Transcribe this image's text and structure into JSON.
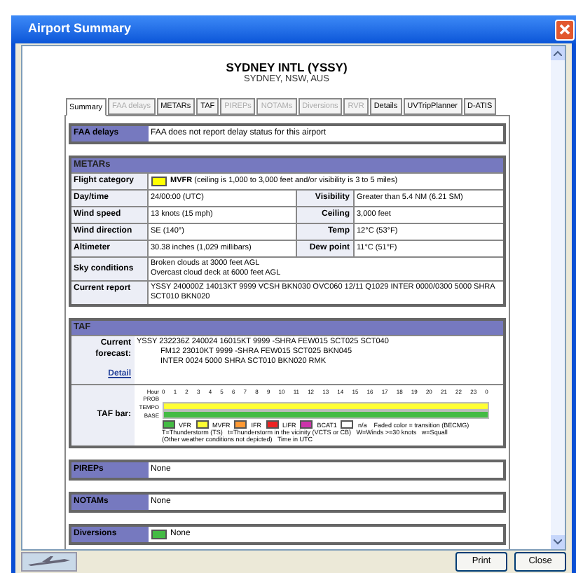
{
  "window": {
    "title": "Airport Summary"
  },
  "airport": {
    "name": "SYDNEY INTL (YSSY)",
    "location": "SYDNEY, NSW, AUS"
  },
  "tabs": [
    {
      "label": "Summary",
      "selected": true,
      "disabled": false
    },
    {
      "label": "FAA delays",
      "selected": false,
      "disabled": true
    },
    {
      "label": "METARs",
      "selected": false,
      "disabled": false
    },
    {
      "label": "TAF",
      "selected": false,
      "disabled": false
    },
    {
      "label": "PIREPs",
      "selected": false,
      "disabled": true
    },
    {
      "label": "NOTAMs",
      "selected": false,
      "disabled": true
    },
    {
      "label": "Diversions",
      "selected": false,
      "disabled": true
    },
    {
      "label": "RVR",
      "selected": false,
      "disabled": true
    },
    {
      "label": "Details",
      "selected": false,
      "disabled": false
    },
    {
      "label": "UVTripPlanner",
      "selected": false,
      "disabled": false
    },
    {
      "label": "D-ATIS",
      "selected": false,
      "disabled": false
    }
  ],
  "faa_delays": {
    "label": "FAA delays",
    "value": "FAA does not report delay status for this airport"
  },
  "metars": {
    "title": "METARs",
    "flight_category": {
      "label": "Flight category",
      "color": "#ffff00",
      "value": "**MVFR** (ceiling is 1,000 to 3,000 feet and/or visibility is 3 to 5 miles)"
    },
    "rows": [
      {
        "label": "Day/time",
        "value": "24/00:00 (UTC)",
        "label_2": "Visibility",
        "value_2": "Greater than 5.4 NM (6.21 SM)"
      },
      {
        "label": "Wind speed",
        "value": "13 knots (15 mph)",
        "label_2": "Ceiling",
        "value_2": "3,000 feet"
      },
      {
        "label": "Wind direction",
        "value": "SE (140°)",
        "label_2": "Temp",
        "value_2": "12°C (53°F)"
      },
      {
        "label": "Altimeter",
        "value": "30.38 inches (1,029 millibars)",
        "label_2": "Dew point",
        "value_2": "11°C (51°F)"
      }
    ],
    "sky": {
      "label": "Sky conditions",
      "lines": [
        "Broken clouds at 3000 feet AGL",
        "Overcast cloud deck at 6000 feet AGL"
      ]
    },
    "report": {
      "label": "Current report",
      "value": "YSSY 240000Z 14013KT 9999 VCSH BKN030 OVC060 12/11 Q1029 INTER 0000/0300 5000 SHRA SCT010 BKN020"
    }
  },
  "taf": {
    "title": "TAF",
    "forecast_label": "Current forecast:",
    "forecast_lines": [
      "YSSY 232236Z 240024 16015KT 9999 -SHRA FEW015 SCT025 SCT040",
      "FM12 23010KT 9999 -SHRA FEW015 SCT025 BKN045",
      "INTER 0024 5000 SHRA SCT010 BKN020 RMK"
    ],
    "detail_link": "Detail",
    "bar_label": "TAF bar:",
    "hour_label": "Hour",
    "hours": [
      "0",
      "1",
      "2",
      "3",
      "4",
      "5",
      "6",
      "7",
      "8",
      "9",
      "10",
      "11",
      "12",
      "13",
      "14",
      "15",
      "16",
      "17",
      "18",
      "19",
      "20",
      "21",
      "22",
      "23",
      "0"
    ],
    "bar_rows": [
      {
        "label": "PROB"
      },
      {
        "label": "TEMPO",
        "color": "#ffff33"
      },
      {
        "label": "BASE",
        "color": "#44bb44"
      }
    ],
    "legend": [
      {
        "label": "VFR",
        "color": "#44bb44"
      },
      {
        "label": "MVFR",
        "color": "#ffff33"
      },
      {
        "label": "IFR",
        "color": "#ff9933"
      },
      {
        "label": "LIFR",
        "color": "#ee2222"
      },
      {
        "label": "BCAT1",
        "color": "#cc33aa"
      },
      {
        "label": "n/a",
        "color": "#ffffff"
      }
    ],
    "legend_note": "Faded color = transition (BECMG)",
    "notes": [
      "T=Thunderstorm (TS)   t=Thunderstorm in the vicinity (VCTS or CB)   W=Winds >=30 knots   w=Squall",
      "(Other weather conditions not depicted)   Time in UTC"
    ]
  },
  "pireps": {
    "label": "PIREPs",
    "value": "None"
  },
  "notams": {
    "label": "NOTAMs",
    "value": "None"
  },
  "diversions": {
    "label": "Diversions",
    "color": "#44bb44",
    "value": "None"
  },
  "buttons": [
    "Print",
    "Close"
  ]
}
